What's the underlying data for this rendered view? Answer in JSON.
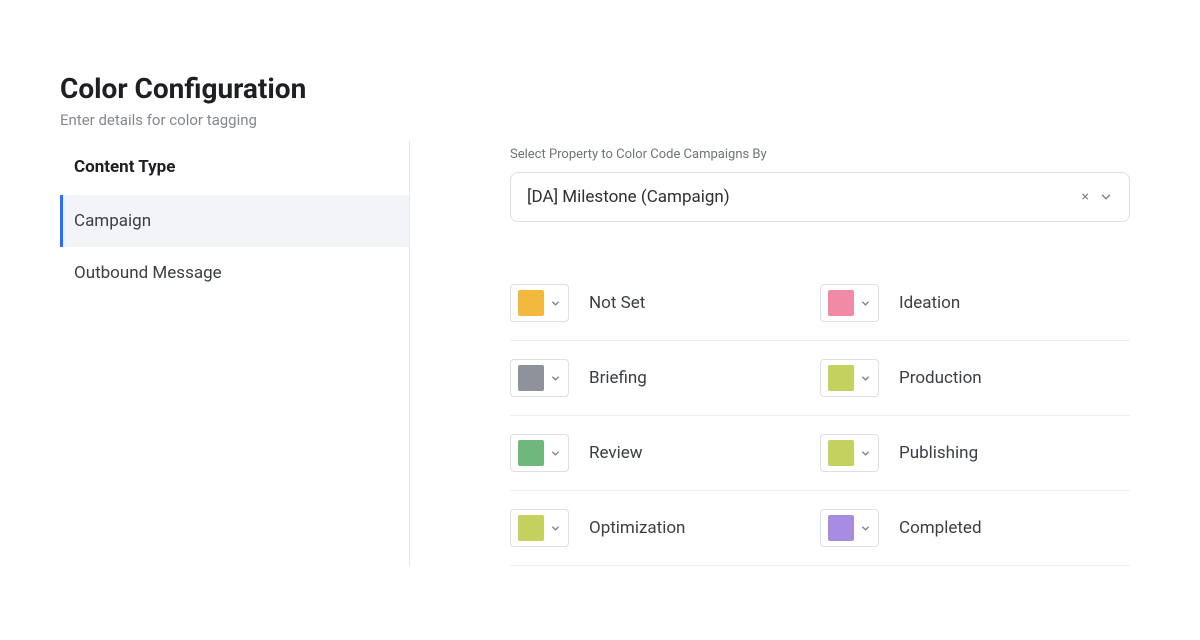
{
  "header": {
    "title": "Color Configuration",
    "subtitle": "Enter details for color tagging"
  },
  "sidebar": {
    "heading": "Content Type",
    "items": [
      {
        "label": "Campaign",
        "active": true
      },
      {
        "label": "Outbound Message",
        "active": false
      }
    ]
  },
  "selector": {
    "label": "Select Property to Color Code Campaigns By",
    "value": "[DA] Milestone (Campaign)",
    "clear_glyph": "×"
  },
  "colors": {
    "entries": [
      {
        "label": "Not Set",
        "swatch": "#f3b93f"
      },
      {
        "label": "Ideation",
        "swatch": "#f18aa4"
      },
      {
        "label": "Briefing",
        "swatch": "#8f929a"
      },
      {
        "label": "Production",
        "swatch": "#c4d15e"
      },
      {
        "label": "Review",
        "swatch": "#6fb77a"
      },
      {
        "label": "Publishing",
        "swatch": "#c4d15e"
      },
      {
        "label": "Optimization",
        "swatch": "#c4d15e"
      },
      {
        "label": "Completed",
        "swatch": "#a68de0"
      }
    ]
  }
}
